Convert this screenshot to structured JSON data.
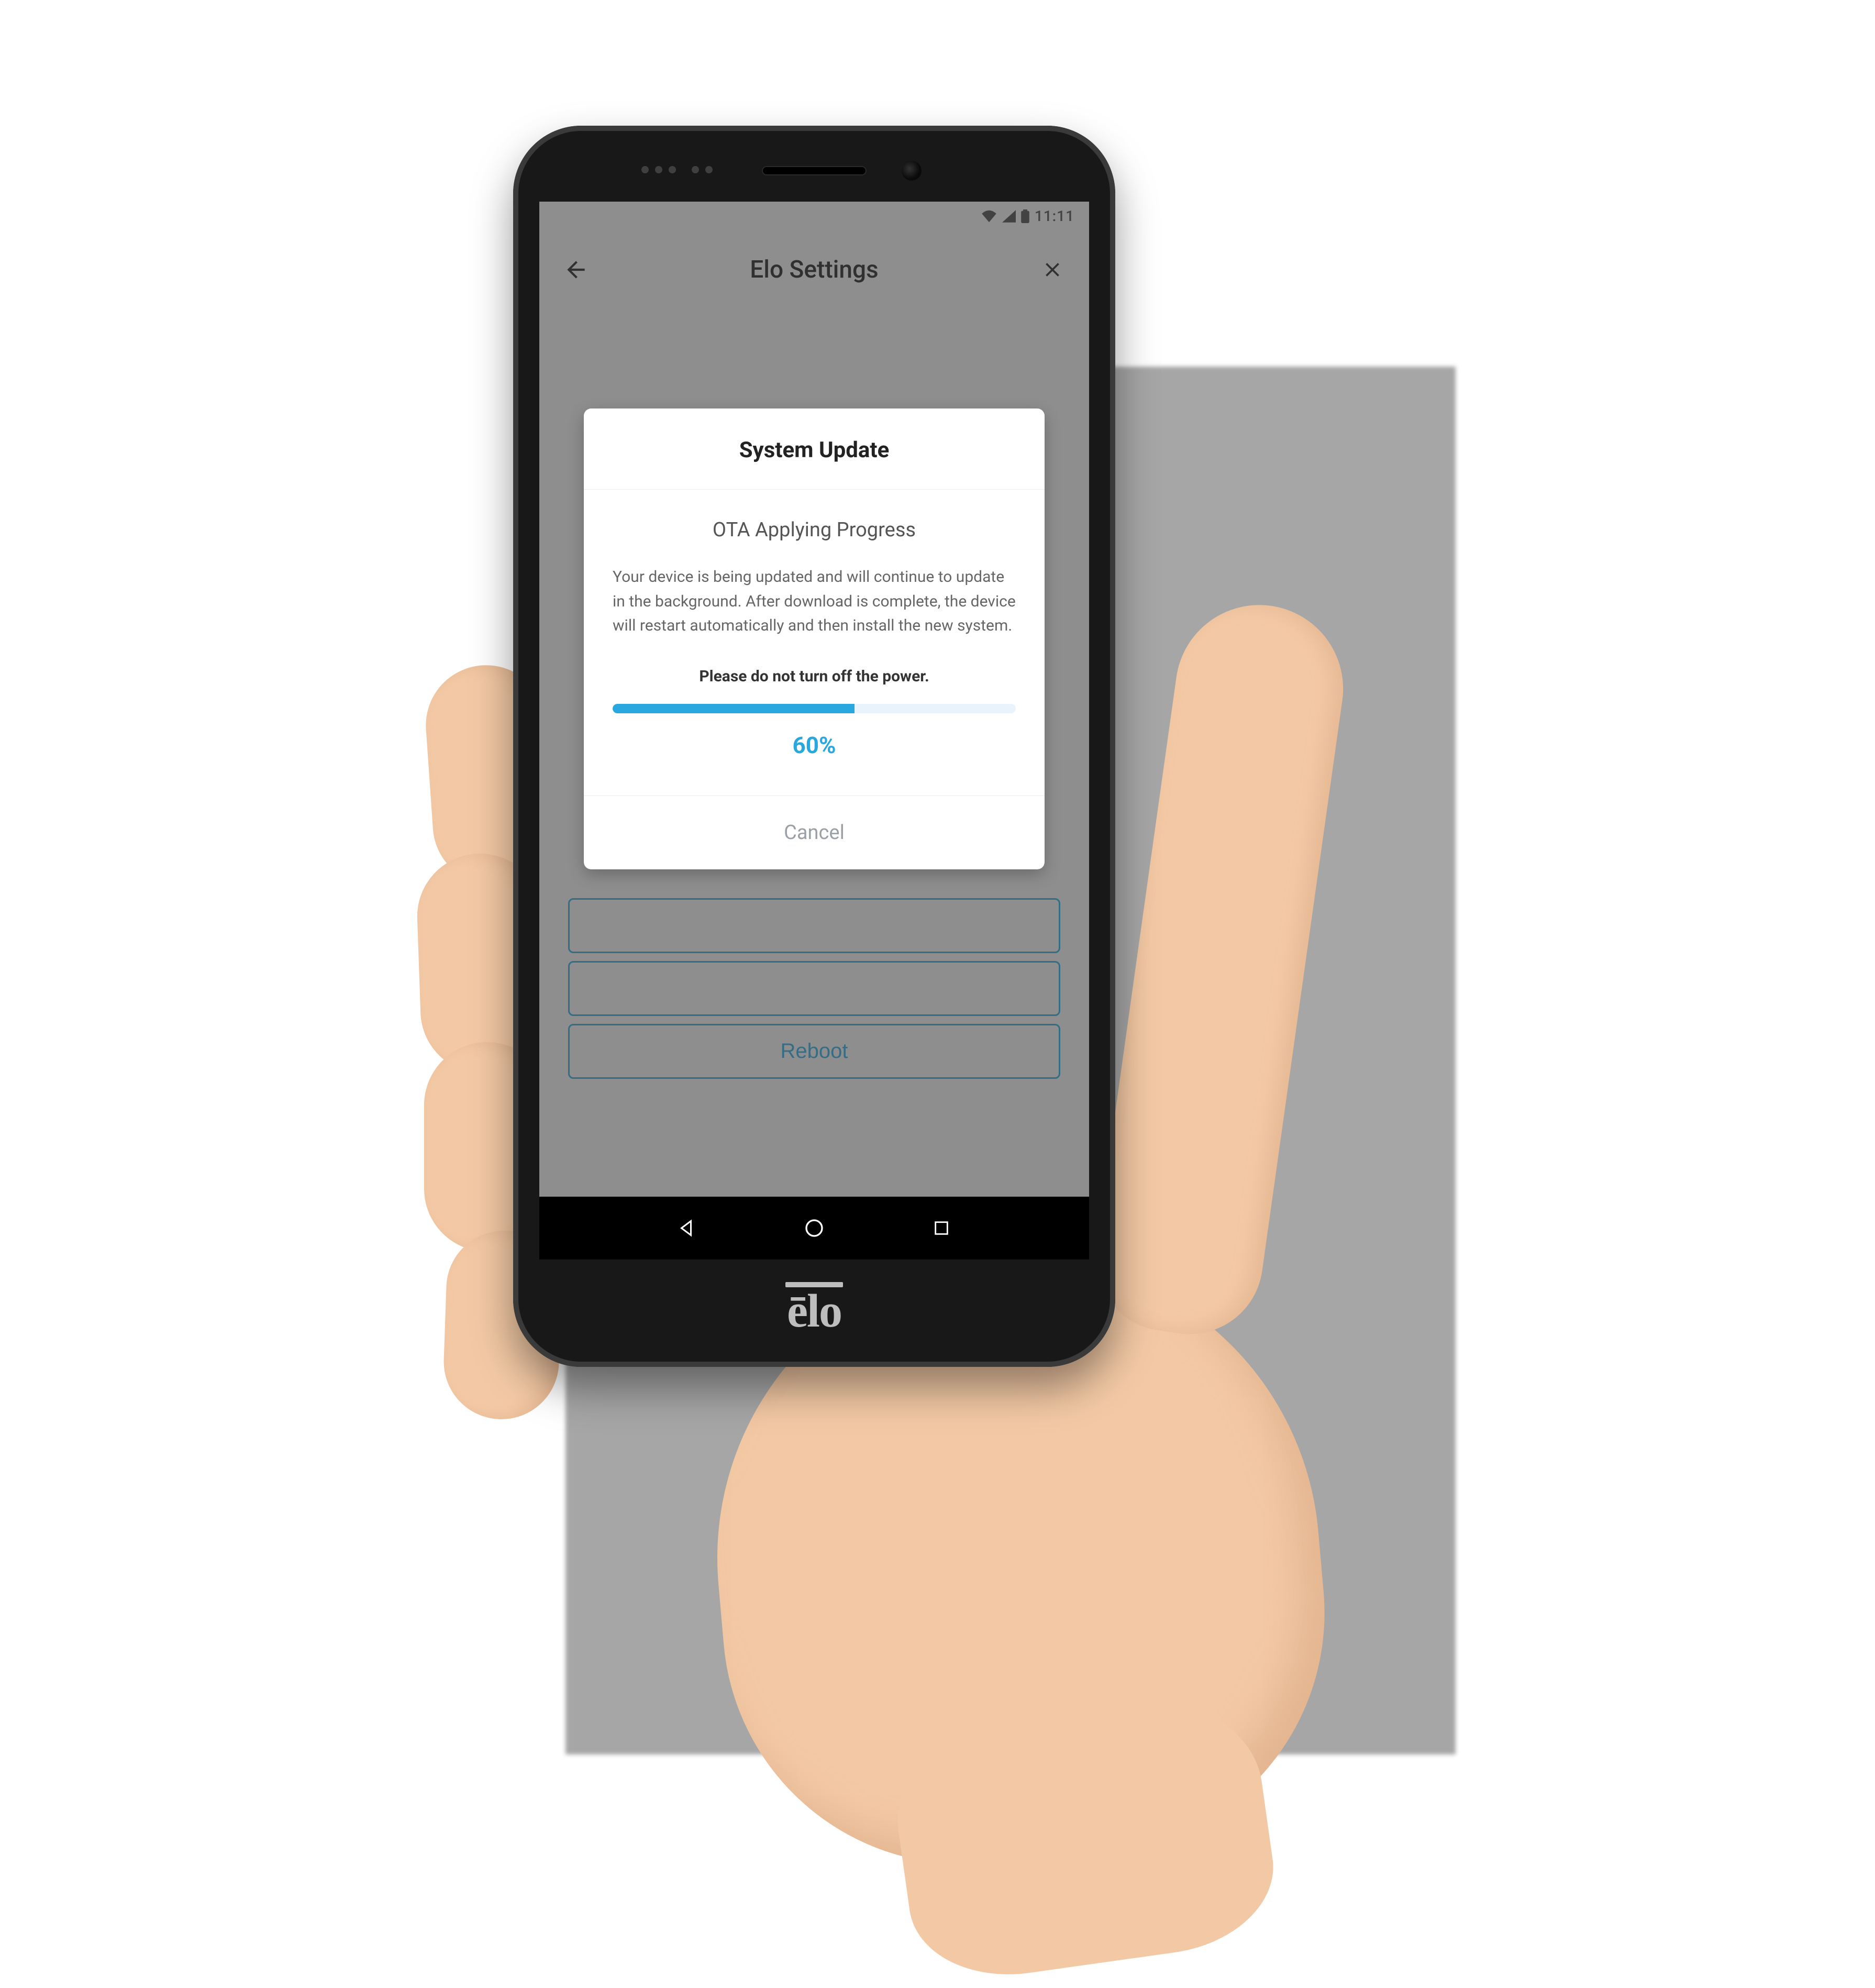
{
  "statusbar": {
    "time": "11:11"
  },
  "header": {
    "title": "Elo Settings"
  },
  "background": {
    "reboot_label": "Reboot"
  },
  "dialog": {
    "title": "System Update",
    "subtitle": "OTA Applying Progress",
    "body": "Your device is being updated and will continue to update in the background. After download is complete, the device will restart automatically and then install the new system.",
    "warning": "Please do not turn off the power.",
    "progress_pct_label": "60%",
    "progress_pct_value": 60,
    "cancel_label": "Cancel"
  },
  "brand": "ēlo"
}
